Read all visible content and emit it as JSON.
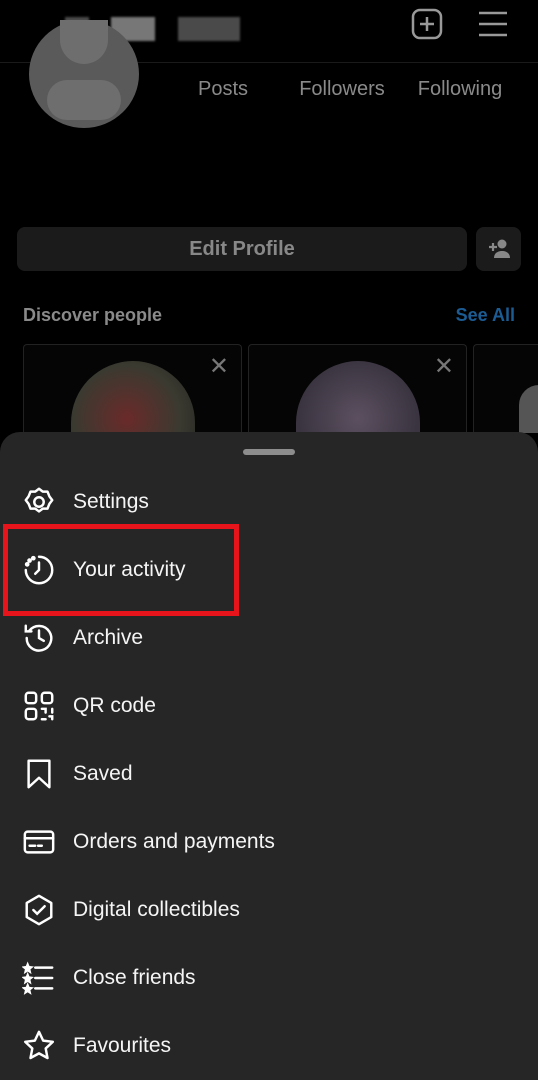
{
  "header": {
    "new_post_icon": "plus-square-icon",
    "menu_icon": "hamburger-icon"
  },
  "profile": {
    "stats": [
      {
        "label": "Posts"
      },
      {
        "label": "Followers"
      },
      {
        "label": "Following"
      }
    ],
    "edit_profile": "Edit Profile",
    "add_person_icon": "person-add-icon"
  },
  "discover": {
    "title": "Discover people",
    "see_all": "See All"
  },
  "menu": {
    "items": [
      {
        "label": "Settings",
        "icon": "gear-icon"
      },
      {
        "label": "Your activity",
        "icon": "activity-clock-icon"
      },
      {
        "label": "Archive",
        "icon": "archive-history-icon"
      },
      {
        "label": "QR code",
        "icon": "qr-code-icon"
      },
      {
        "label": "Saved",
        "icon": "bookmark-icon"
      },
      {
        "label": "Orders and payments",
        "icon": "card-icon"
      },
      {
        "label": "Digital collectibles",
        "icon": "shield-check-icon"
      },
      {
        "label": "Close friends",
        "icon": "star-list-icon"
      },
      {
        "label": "Favourites",
        "icon": "star-icon"
      }
    ]
  },
  "colors": {
    "highlight": "#e8141c",
    "link": "#1c5c94",
    "sheet": "#262626"
  }
}
